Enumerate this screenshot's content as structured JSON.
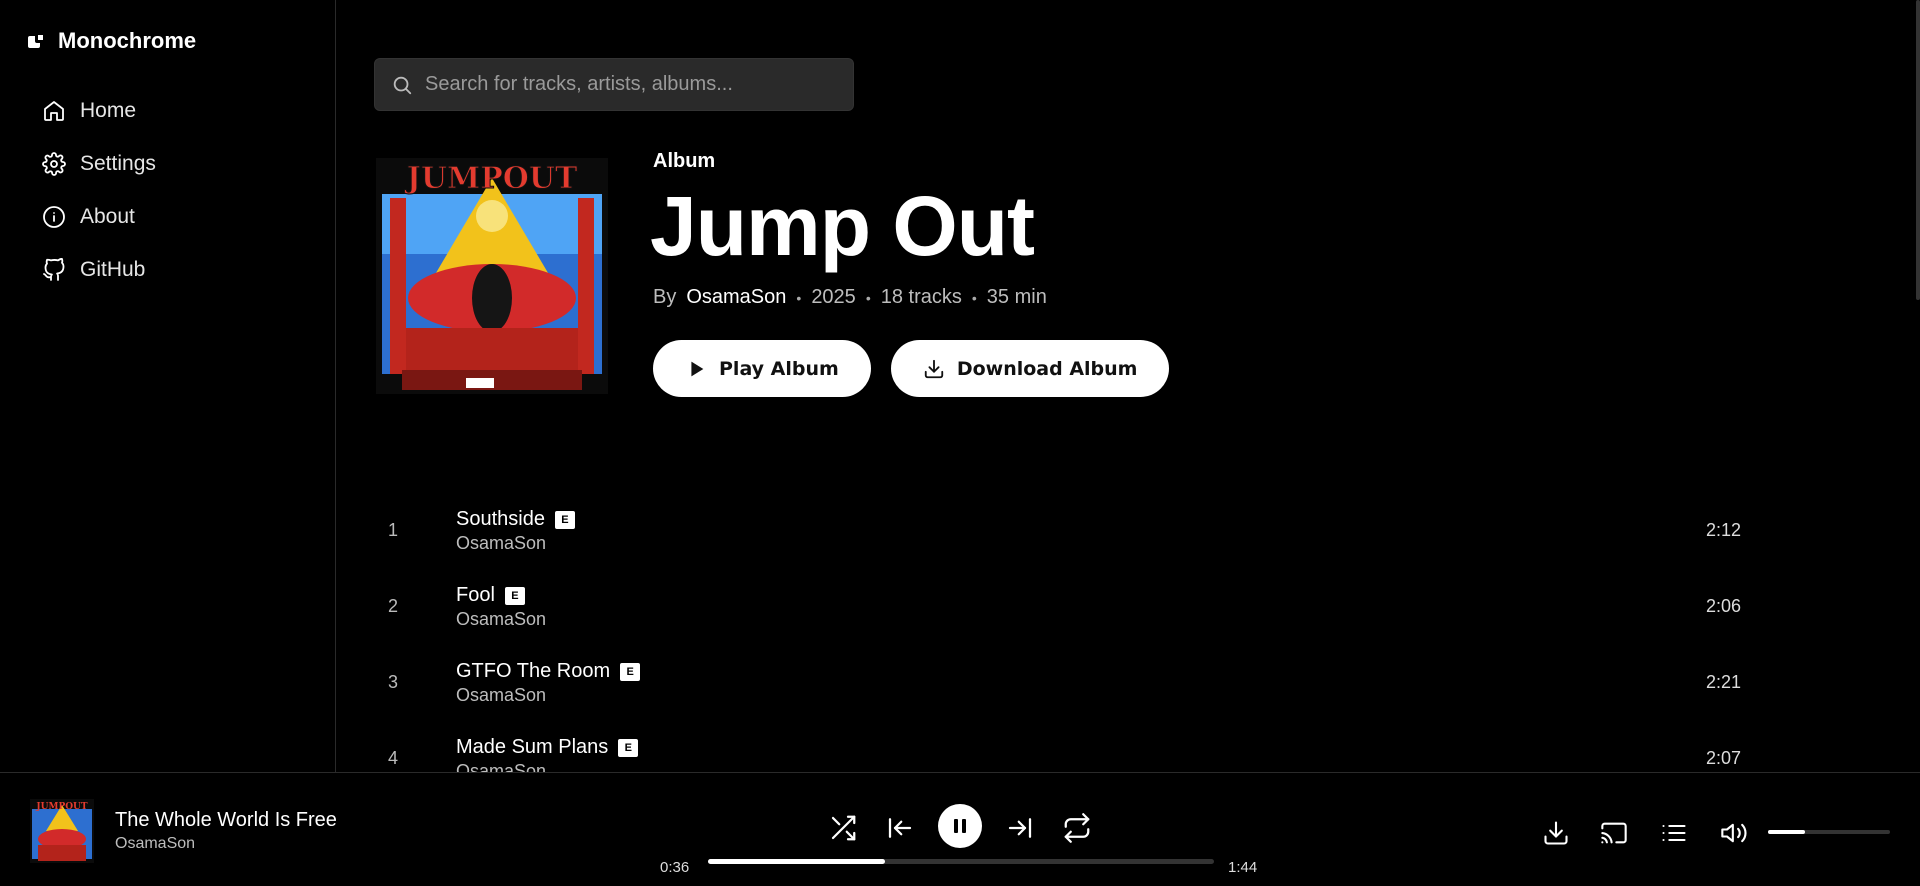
{
  "brand": {
    "name": "Monochrome"
  },
  "nav": [
    {
      "label": "Home",
      "icon": "home-icon"
    },
    {
      "label": "Settings",
      "icon": "gear-icon"
    },
    {
      "label": "About",
      "icon": "info-icon"
    },
    {
      "label": "GitHub",
      "icon": "github-icon"
    }
  ],
  "search": {
    "placeholder": "Search for tracks, artists, albums..."
  },
  "album": {
    "type": "Album",
    "title": "Jump Out",
    "by_label": "By",
    "artist": "OsamaSon",
    "year": "2025",
    "tracks_count": "18 tracks",
    "duration": "35 min",
    "play_label": "Play Album",
    "download_label": "Download Album"
  },
  "tracks": [
    {
      "num": "1",
      "title": "Southside",
      "explicit": "E",
      "artist": "OsamaSon",
      "duration": "2:12"
    },
    {
      "num": "2",
      "title": "Fool",
      "explicit": "E",
      "artist": "OsamaSon",
      "duration": "2:06"
    },
    {
      "num": "3",
      "title": "GTFO The Room",
      "explicit": "E",
      "artist": "OsamaSon",
      "duration": "2:21"
    },
    {
      "num": "4",
      "title": "Made Sum Plans",
      "explicit": "E",
      "artist": "OsamaSon",
      "duration": "2:07"
    }
  ],
  "player": {
    "title": "The Whole World Is Free",
    "artist": "OsamaSon",
    "elapsed": "0:36",
    "total": "1:44",
    "progress_fraction": 0.35,
    "volume_fraction": 0.3
  },
  "colors": {
    "background": "#000000",
    "accent": "#ffffff",
    "muted": "#bdbdbd"
  }
}
